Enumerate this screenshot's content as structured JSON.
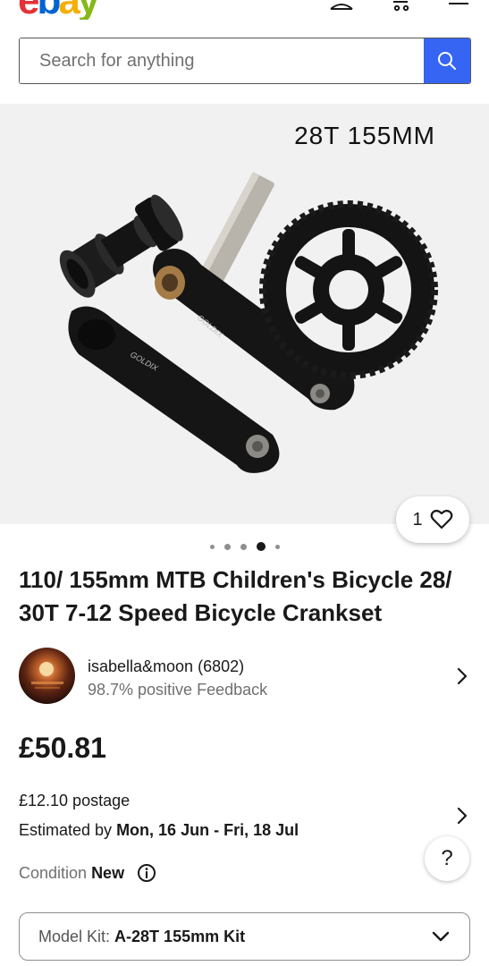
{
  "header": {
    "logo": {
      "e": "e",
      "b": "b",
      "a": "a",
      "y": "y"
    }
  },
  "search": {
    "placeholder": "Search for anything"
  },
  "gallery": {
    "caption": "28T   155MM",
    "likes": "1",
    "dots_count": 5,
    "active_index": 3
  },
  "product": {
    "title": "110/ 155mm MTB Children's Bicycle 28/ 30T 7-12 Speed Bicycle Crankset"
  },
  "seller": {
    "name": "isabella&moon (6802)",
    "feedback": "98.7% positive Feedback"
  },
  "price": "£50.81",
  "shipping": {
    "postage": "£12.10 postage",
    "estimated_label": "Estimated by",
    "estimated_dates": "Mon, 16 Jun - Fri, 18 Jul"
  },
  "condition": {
    "label": "Condition",
    "value": "New"
  },
  "help": {
    "label": "?"
  },
  "variation": {
    "label": "Model Kit:",
    "value": "A-28T 155mm Kit"
  }
}
